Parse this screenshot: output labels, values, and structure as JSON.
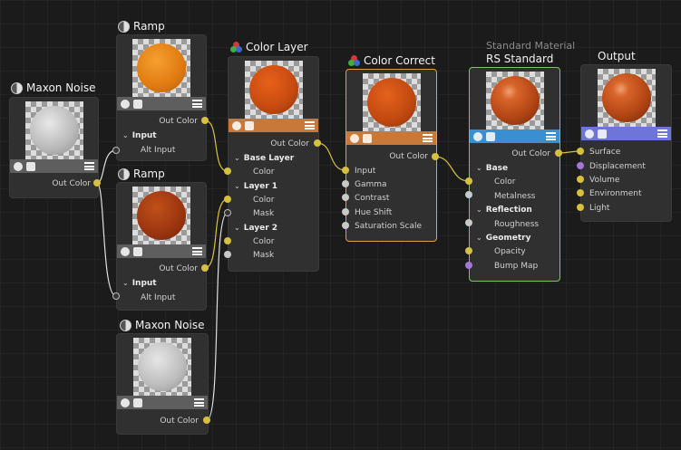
{
  "nodes": {
    "maxon_noise_1": {
      "title": "Maxon Noise",
      "out": "Out Color"
    },
    "ramp_1": {
      "title": "Ramp",
      "out": "Out Color",
      "group": "Input",
      "input": "Alt Input"
    },
    "ramp_2": {
      "title": "Ramp",
      "out": "Out Color",
      "group": "Input",
      "input": "Alt Input"
    },
    "maxon_noise_2": {
      "title": "Maxon Noise",
      "out": "Out Color"
    },
    "color_layer": {
      "title": "Color Layer",
      "out": "Out Color",
      "base_group": "Base Layer",
      "base_color": "Color",
      "layer1_group": "Layer 1",
      "layer1_color": "Color",
      "layer1_mask": "Mask",
      "layer2_group": "Layer 2",
      "layer2_color": "Color",
      "layer2_mask": "Mask"
    },
    "color_correct": {
      "title": "Color Correct",
      "out": "Out Color",
      "inputs": [
        "Input",
        "Gamma",
        "Contrast",
        "Hue Shift",
        "Saturation Scale"
      ]
    },
    "rs_standard": {
      "subtitle": "Standard Material",
      "title": "RS Standard",
      "out": "Out Color",
      "base_group": "Base",
      "color": "Color",
      "metalness": "Metalness",
      "refl_group": "Reflection",
      "roughness": "Roughness",
      "geo_group": "Geometry",
      "opacity": "Opacity",
      "bump": "Bump Map"
    },
    "output": {
      "title": "Output",
      "inputs": [
        "Surface",
        "Displacement",
        "Volume",
        "Environment",
        "Light"
      ]
    }
  },
  "colors": {
    "background": "#1b1b1b",
    "port_color": "#d6c040",
    "port_float": "#c8c8c8",
    "port_vector": "#a575d8",
    "bar_noise": "#5e5e5e",
    "bar_layer": "#c8793a",
    "bar_rs": "#3a8fd0",
    "bar_output": "#6f74d8",
    "selected_orange": "#e0a040",
    "selected_green": "#7fc26a"
  },
  "icons": [
    "maxon-logo-icon",
    "color-layer-icon",
    "shader-icon",
    "image-icon",
    "menu-icon"
  ]
}
